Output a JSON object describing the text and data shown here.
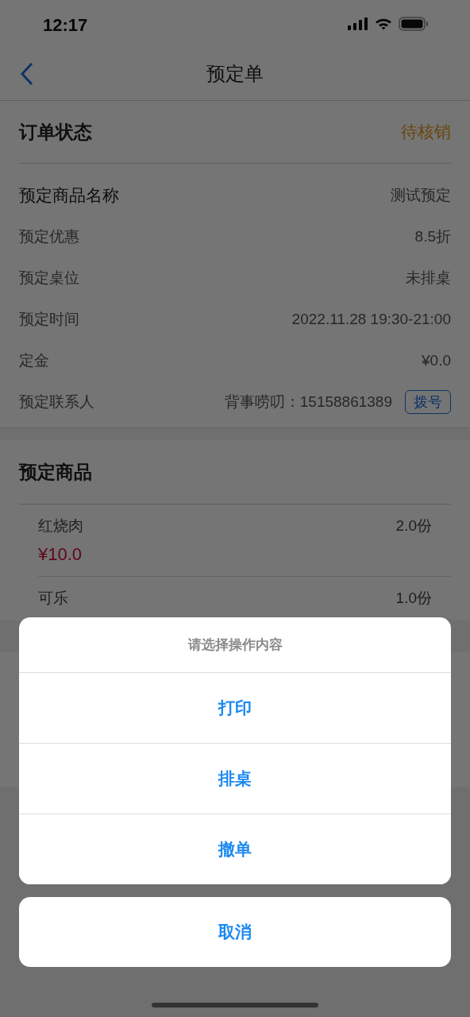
{
  "status_bar": {
    "time": "12:17"
  },
  "nav": {
    "title": "预定单"
  },
  "order": {
    "title": "订单状态",
    "status": "待核销",
    "fields": [
      {
        "label": "预定商品名称",
        "value": "测试预定",
        "kind": "primary"
      },
      {
        "label": "预定优惠",
        "value": "8.5折",
        "kind": "secondary"
      },
      {
        "label": "预定桌位",
        "value": "未排桌",
        "kind": "secondary"
      },
      {
        "label": "预定时间",
        "value": "2022.11.28 19:30-21:00",
        "kind": "secondary"
      },
      {
        "label": "定金",
        "value": "¥0.0",
        "kind": "secondary"
      }
    ],
    "contact": {
      "label": "预定联系人",
      "value": "背事唠叨：15158861389",
      "button": "拨号"
    }
  },
  "goods": {
    "title": "预定商品",
    "items": [
      {
        "name": "红烧肉",
        "qty": "2.0份",
        "price": "¥10.0"
      },
      {
        "name": "可乐",
        "qty": "1.0份"
      }
    ]
  },
  "action_sheet": {
    "title": "请选择操作内容",
    "options": [
      "打印",
      "排桌",
      "撤单"
    ],
    "cancel": "取消"
  }
}
